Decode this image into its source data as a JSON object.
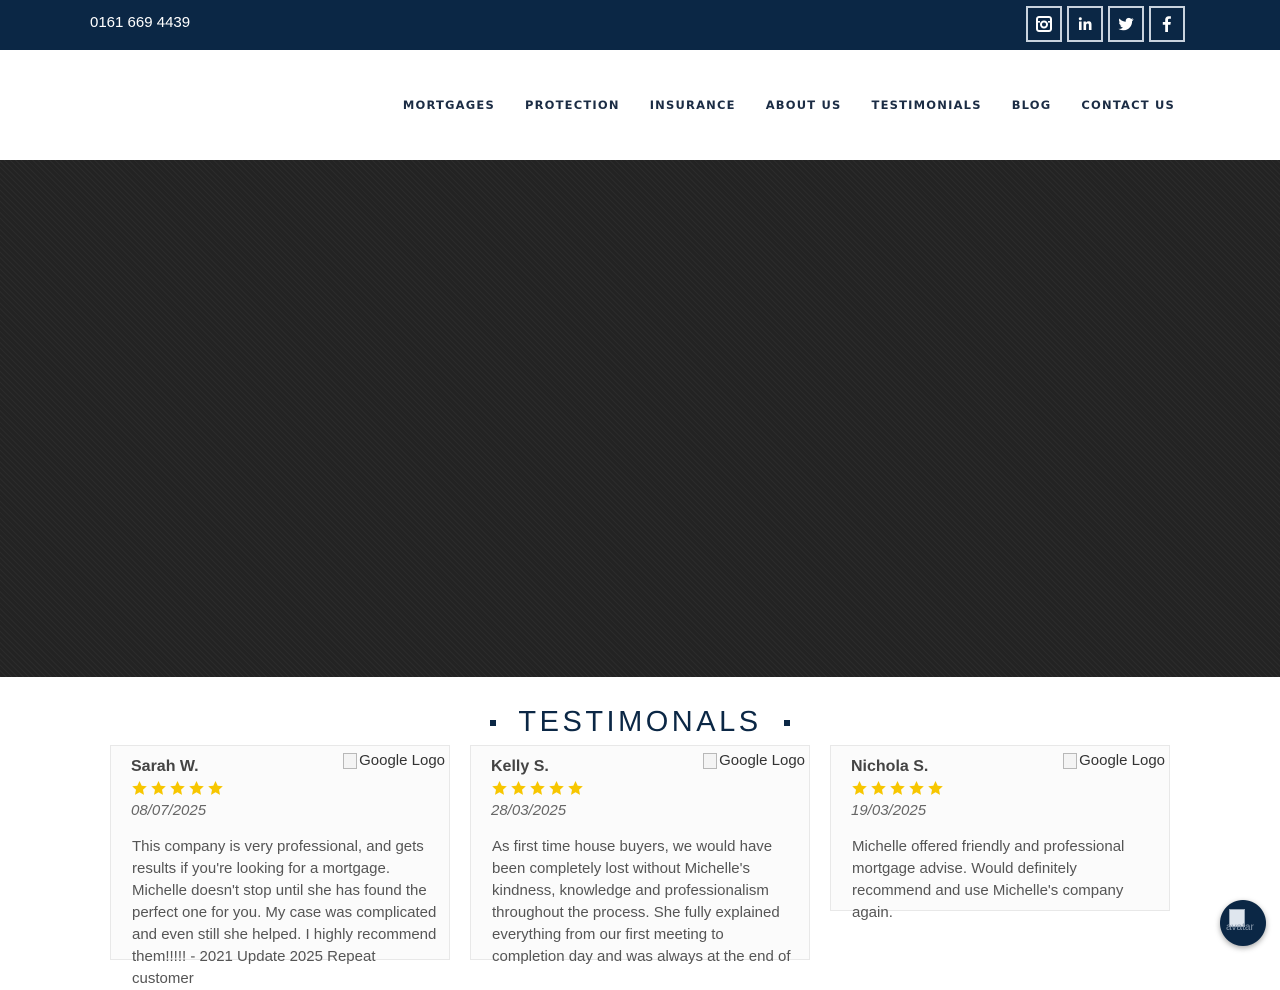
{
  "topbar": {
    "phone": "0161 669 4439",
    "socials": [
      {
        "icon": "instagram-icon"
      },
      {
        "icon": "linkedin-icon"
      },
      {
        "icon": "twitter-icon"
      },
      {
        "icon": "facebook-icon"
      }
    ]
  },
  "nav": {
    "items": [
      "MORTGAGES",
      "PROTECTION",
      "INSURANCE",
      "ABOUT US",
      "TESTIMONIALS",
      "BLOG",
      "CONTACT US"
    ]
  },
  "testimonials": {
    "heading": "TESTIMONALS",
    "logo_alt": "Google Logo",
    "star_color": "#f7c600",
    "cards": [
      {
        "name": "Sarah W.",
        "rating": 5,
        "date": "08/07/2025",
        "text": "This company is very professional, and gets results if you're looking for a mortgage. Michelle doesn't stop until she has found the perfect one for you. My case was complicated and even still she helped. I highly recommend them!!!!! - 2021 Update 2025 Repeat customer"
      },
      {
        "name": "Kelly S.",
        "rating": 5,
        "date": "28/03/2025",
        "text": "As first time house buyers, we would have been completely lost without Michelle's kindness, knowledge and professionalism throughout the process. She fully explained everything from our first meeting to completion day and was always at the end of"
      },
      {
        "name": "Nichola S.",
        "rating": 5,
        "date": "19/03/2025",
        "text": "Michelle offered friendly and professional mortgage advise. Would definitely recommend and use Michelle's company again."
      }
    ]
  },
  "chat": {
    "icon": "chat-icon",
    "alt": "avatar"
  },
  "colors": {
    "navy": "#0b2745",
    "hero_bg": "#232323"
  }
}
